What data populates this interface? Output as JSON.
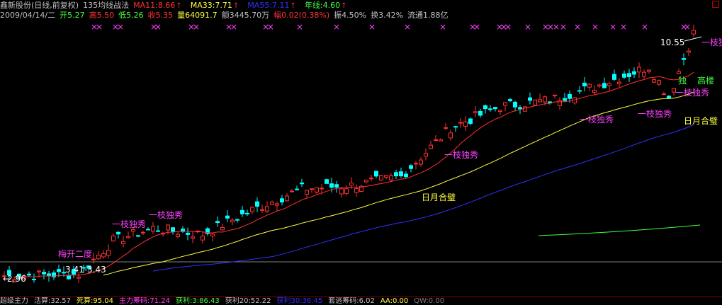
{
  "header": {
    "title": "鑫新股份(日线,前复权)",
    "indicator": "135均线战法",
    "ma11": "MA11:8.66",
    "ma33": "MA33:7.71",
    "ma55": "MA55:7.11",
    "nianxian": "年线:4.60",
    "date": "2009/04/14/二",
    "open": "开5.27",
    "high": "高5.50",
    "low": "低5.26",
    "close": "收5.35",
    "volume": "量64091.7",
    "amount": "额3445.70万",
    "change": "幅0.02(0.38%)",
    "amplitude": "振4.50%",
    "turnover": "换3.42%",
    "float": "流通1.88亿"
  },
  "colors": {
    "ma11": "#ff3030",
    "ma33": "#ffff40",
    "ma55": "#3030ff",
    "nianxian": "#40ff40",
    "up": "#ff3030",
    "down": "#00ffff",
    "label": "#ff40ff"
  },
  "annotations": {
    "price_high": "10.55",
    "price_low": "2.96",
    "range": "3.41-3.43",
    "yizhixiu": "一枝独秀",
    "riyuehebi": "日月合璧",
    "meikaiyidu": "梅开二度",
    "dulou": "独",
    "gaolou": "高楼"
  },
  "bottom": {
    "l1": "超级主力",
    "l2": "活算:32.57",
    "l3": "死算:95.04",
    "l4": "主力筹码:71.24",
    "l5": "获利:3:86.43",
    "l6": "获利20:52.22",
    "l7": "获利30:36.45",
    "l8": "套逃筹码:6.02",
    "l9": "AA:0.00",
    "l10": "QW:0.00"
  }
}
